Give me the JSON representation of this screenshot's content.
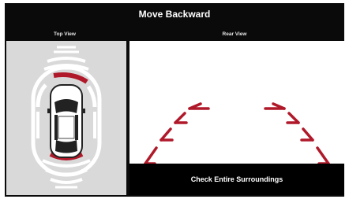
{
  "title": "Move Backward",
  "views": {
    "top_label": "Top View",
    "rear_label": "Rear View"
  },
  "rear": {
    "message": "Check Entire Surroundings"
  },
  "sensors": {
    "front": "inactive",
    "front_right": "warning",
    "rear": "warning"
  },
  "colors": {
    "background": "#0a0a0a",
    "top_view_bg": "#d9d9d9",
    "arc": "#ffffff",
    "warning": "#b0192a",
    "guide_line": "#b0192a"
  },
  "icons": {
    "vehicle": "car-top-icon",
    "guides": "parking-guide-lines"
  }
}
